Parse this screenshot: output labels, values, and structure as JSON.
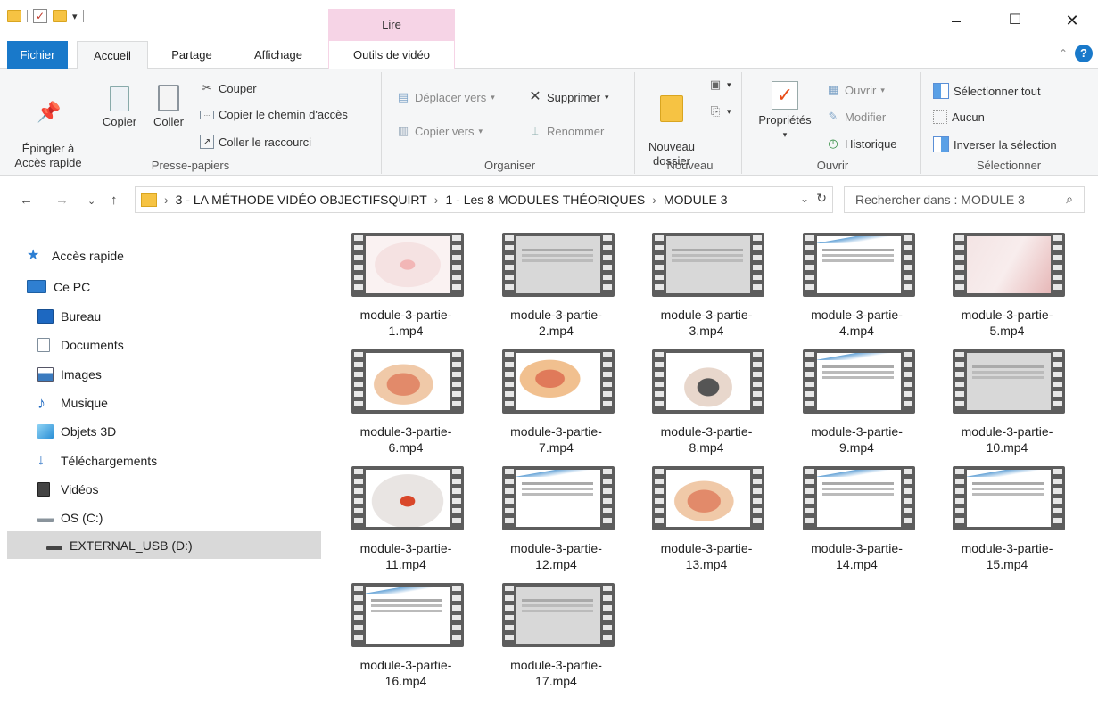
{
  "titlebar": {
    "contextual_header": "Lire",
    "minimize": "–",
    "maximize": "☐",
    "close": "✕"
  },
  "tabs": {
    "file": "Fichier",
    "home": "Accueil",
    "share": "Partage",
    "view": "Affichage",
    "video_tools": "Outils de vidéo"
  },
  "ribbon": {
    "clipboard": {
      "label": "Presse-papiers",
      "pin": "Épingler à\nAccès rapide",
      "copy": "Copier",
      "paste": "Coller",
      "cut": "Couper",
      "copy_path": "Copier le chemin d'accès",
      "paste_shortcut": "Coller le raccourci"
    },
    "organize": {
      "label": "Organiser",
      "move_to": "Déplacer vers",
      "copy_to": "Copier vers",
      "delete": "Supprimer",
      "rename": "Renommer"
    },
    "new": {
      "label": "Nouveau",
      "new_folder": "Nouveau\ndossier"
    },
    "open": {
      "label": "Ouvrir",
      "properties": "Propriétés",
      "open": "Ouvrir",
      "edit": "Modifier",
      "history": "Historique"
    },
    "select": {
      "label": "Sélectionner",
      "select_all": "Sélectionner tout",
      "select_none": "Aucun",
      "invert": "Inverser la sélection"
    }
  },
  "address": {
    "crumbs": [
      "3 - LA MÉTHODE VIDÉO OBJECTIFSQUIRT",
      "1 - Les 8 MODULES THÉORIQUES",
      "MODULE 3"
    ],
    "search_placeholder": "Rechercher dans : MODULE 3"
  },
  "sidebar": {
    "items": [
      {
        "label": "Accès rapide",
        "icon": "star-icon"
      },
      {
        "label": "Ce PC",
        "icon": "computer-icon"
      },
      {
        "label": "Bureau",
        "icon": "desktop-icon"
      },
      {
        "label": "Documents",
        "icon": "documents-icon"
      },
      {
        "label": "Images",
        "icon": "images-icon"
      },
      {
        "label": "Musique",
        "icon": "music-icon"
      },
      {
        "label": "Objets 3D",
        "icon": "objects-3d-icon"
      },
      {
        "label": "Téléchargements",
        "icon": "downloads-icon"
      },
      {
        "label": "Vidéos",
        "icon": "videos-icon"
      },
      {
        "label": "OS (C:)",
        "icon": "drive-icon"
      },
      {
        "label": "EXTERNAL_USB (D:)",
        "icon": "usb-drive-icon"
      }
    ],
    "selected": "EXTERNAL_USB (D:)"
  },
  "files": [
    {
      "name": "module-3-partie-\n1.mp4",
      "thumb": "spiral"
    },
    {
      "name": "module-3-partie-\n2.mp4",
      "thumb": "gray"
    },
    {
      "name": "module-3-partie-\n3.mp4",
      "thumb": "gray"
    },
    {
      "name": "module-3-partie-\n4.mp4",
      "thumb": "slide"
    },
    {
      "name": "module-3-partie-\n5.mp4",
      "thumb": "pink"
    },
    {
      "name": "module-3-partie-\n6.mp4",
      "thumb": "anat"
    },
    {
      "name": "module-3-partie-\n7.mp4",
      "thumb": "anat2"
    },
    {
      "name": "module-3-partie-\n8.mp4",
      "thumb": "stone"
    },
    {
      "name": "module-3-partie-\n9.mp4",
      "thumb": "slide"
    },
    {
      "name": "module-3-partie-\n10.mp4",
      "thumb": "gray"
    },
    {
      "name": "module-3-partie-\n11.mp4",
      "thumb": "uterus"
    },
    {
      "name": "module-3-partie-\n12.mp4",
      "thumb": "slide"
    },
    {
      "name": "module-3-partie-\n13.mp4",
      "thumb": "anat"
    },
    {
      "name": "module-3-partie-\n14.mp4",
      "thumb": "slide"
    },
    {
      "name": "module-3-partie-\n15.mp4",
      "thumb": "slide"
    },
    {
      "name": "module-3-partie-\n16.mp4",
      "thumb": "slide"
    },
    {
      "name": "module-3-partie-\n17.mp4",
      "thumb": "gray"
    }
  ],
  "colors": {
    "accent": "#1979ca",
    "video_tools_tab": "#f6d4e6",
    "selection": "#d9d9d9",
    "folder": "#f6c343"
  }
}
